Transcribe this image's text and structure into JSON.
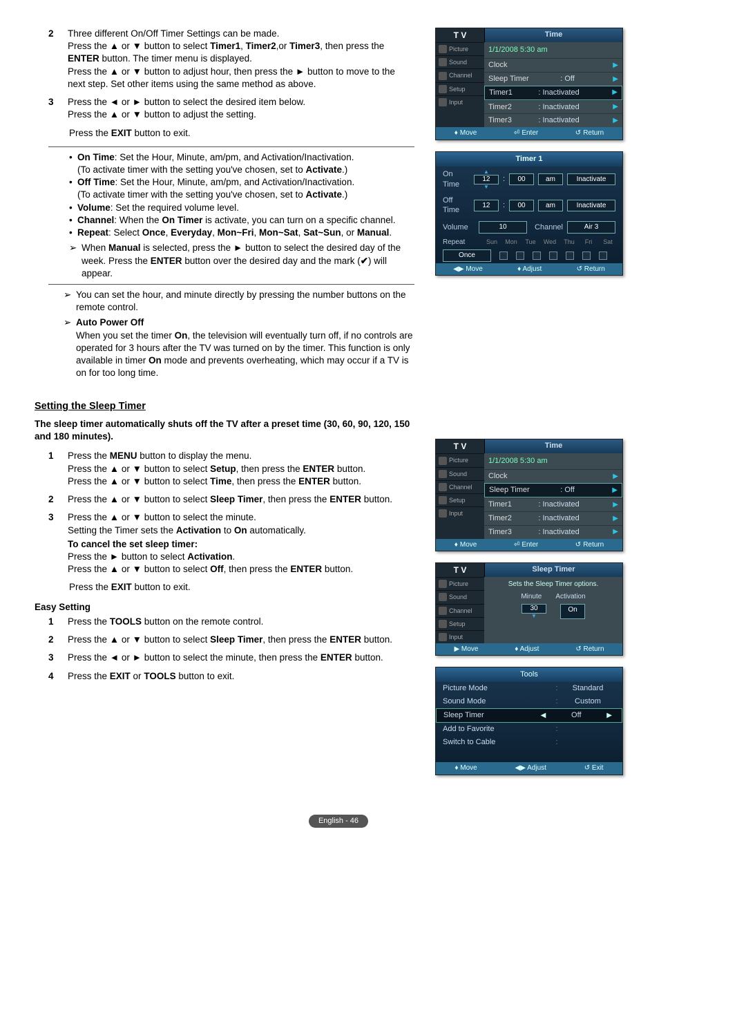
{
  "steps_top": {
    "s2": {
      "num": "2",
      "l1": "Three different On/Off Timer Settings can be made.",
      "l2a": "Press the ▲ or ▼ button to select ",
      "l2b1": "Timer1",
      "l2c": ", ",
      "l2b2": "Timer2",
      "l2d": ",or ",
      "l2b3": "Timer3",
      "l2e": ", then press the ",
      "l3a": "ENTER",
      "l3b": " button. The timer menu is displayed.",
      "l4": "Press the ▲ or ▼ button to adjust hour, then press the ► button to move to the next step. Set other items using the same method as above."
    },
    "s3": {
      "num": "3",
      "l1": "Press the ◄ or ► button to select the desired item below.",
      "l2": "Press the ▲ or ▼ button to adjust the setting.",
      "exit_a": "Press the ",
      "exit_b": "EXIT",
      "exit_c": " button to exit."
    }
  },
  "bullets": {
    "b1a": "On Time",
    "b1b": ": Set the Hour, Minute, am/pm, and Activation/Inactivation.",
    "b1c": "(To activate timer with the setting you've chosen, set to ",
    "b1d": "Activate",
    "b1e": ".)",
    "b2a": "Off Time",
    "b2b": ": Set the Hour, Minute, am/pm, and Activation/Inactivation.",
    "b2c": "(To activate timer with the setting you've chosen, set to ",
    "b2d": "Activate",
    "b2e": ".)",
    "b3a": "Volume",
    "b3b": ": Set the required volume level.",
    "b4a": "Channel",
    "b4b": ": When the ",
    "b4c": "On Timer",
    "b4d": " is activate, you can turn on a specific channel.",
    "b5a": "Repeat",
    "b5b": ": Select ",
    "opts": [
      "Once",
      "Everyday",
      "Mon~Fri",
      "Mon~Sat",
      "Sat~Sun",
      "Manual"
    ],
    "or": ", or ",
    "sep": ", ",
    "b5end": ".",
    "b5sub": "When ",
    "b5sub_b": "Manual",
    "b5sub_c": " is selected, press the ► button to select the desired day of the week. Press the ",
    "b5sub_d": "ENTER",
    "b5sub_e": " button over the desired day and the mark (",
    "b5sub_f": "✔",
    "b5sub_g": ") will appear."
  },
  "notes": {
    "n1": "You can set the hour, and minute directly by pressing the number buttons on the remote control.",
    "n2_title": "Auto Power Off",
    "n2_body_a": "When you set the timer ",
    "n2_body_b": "On",
    "n2_body_c": ", the television will eventually turn off, if no controls are operated for 3 hours after the TV was turned on by the timer. This function is only available in timer ",
    "n2_body_d": "On",
    "n2_body_e": " mode and prevents overheating, which may occur if a TV is on for too long time."
  },
  "sleep": {
    "title": "Setting the Sleep Timer",
    "lead": "The sleep timer automatically shuts off the TV after a preset time (30, 60, 90, 120, 150 and 180 minutes).",
    "s1": {
      "num": "1",
      "a": "Press the ",
      "b": "MENU",
      "c": " button to display the menu.",
      "d": "Press the ▲ or ▼ button to select ",
      "e": "Setup",
      "f": ", then press the ",
      "g": "ENTER",
      "h": " button.",
      "i": "Press the ▲ or ▼ button to select ",
      "j": "Time",
      "k": ", then press the ",
      "l": "ENTER",
      "m": " button."
    },
    "s2": {
      "num": "2",
      "a": "Press the ▲ or ▼ button to select ",
      "b": "Sleep Timer",
      "c": ", then press the ",
      "d": "ENTER",
      "e": " button."
    },
    "s3": {
      "num": "3",
      "a": "Press the ▲ or ▼ button to select the minute.",
      "b": "Setting the Timer sets the ",
      "c": "Activation",
      "d": " to ",
      "e": "On",
      "f": " automatically.",
      "cancel_t": "To cancel the set sleep timer:",
      "g": "Press the ► button to select ",
      "h": "Activation",
      "i": ".",
      "j": "Press the ▲ or ▼ button to select ",
      "k": "Off",
      "l": ", then press the ",
      "m": "ENTER",
      "n": " button.",
      "exit_a": "Press the ",
      "exit_b": "EXIT",
      "exit_c": " button to exit."
    }
  },
  "easy": {
    "title": "Easy Setting",
    "s1": {
      "num": "1",
      "a": "Press the ",
      "b": "TOOLS",
      "c": " button on the remote control."
    },
    "s2": {
      "num": "2",
      "a": "Press the ▲ or ▼ button to select ",
      "b": "Sleep Timer",
      "c": ", then press the ",
      "d": "ENTER",
      "e": " button."
    },
    "s3": {
      "num": "3",
      "a": "Press the ◄ or ► button to select the minute, then press the ",
      "b": "ENTER",
      "c": " button."
    },
    "s4": {
      "num": "4",
      "a": "Press the ",
      "b": "EXIT",
      "c": " or ",
      "d": "TOOLS",
      "e": " button to exit."
    }
  },
  "osd": {
    "tv": "T V",
    "title": "Time",
    "date": "1/1/2008 5:30 am",
    "side": [
      "Picture",
      "Sound",
      "Channel",
      "Setup",
      "Input"
    ],
    "rows1": [
      {
        "label": "Clock",
        "value": "",
        "arrow": true,
        "hl": false
      },
      {
        "label": "Sleep Timer",
        "value": ": Off",
        "arrow": true,
        "hl": false
      },
      {
        "label": "Timer1",
        "value": ": Inactivated",
        "arrow": true,
        "hl": true
      },
      {
        "label": "Timer2",
        "value": ": Inactivated",
        "arrow": true,
        "hl": false
      },
      {
        "label": "Timer3",
        "value": ": Inactivated",
        "arrow": true,
        "hl": false
      }
    ],
    "rows2": [
      {
        "label": "Clock",
        "value": "",
        "arrow": true,
        "hl": false
      },
      {
        "label": "Sleep Timer",
        "value": ": Off",
        "arrow": true,
        "hl": true
      },
      {
        "label": "Timer1",
        "value": ": Inactivated",
        "arrow": true,
        "hl": false
      },
      {
        "label": "Timer2",
        "value": ": Inactivated",
        "arrow": true,
        "hl": false
      },
      {
        "label": "Timer3",
        "value": ": Inactivated",
        "arrow": true,
        "hl": false
      }
    ],
    "footer": {
      "move": "Move",
      "enter": "Enter",
      "ret": "Return"
    }
  },
  "timer1": {
    "title": "Timer 1",
    "on": {
      "label": "On Time",
      "h": "12",
      "m": "00",
      "ap": "am",
      "act": "Inactivate"
    },
    "off": {
      "label": "Off Time",
      "h": "12",
      "m": "00",
      "ap": "am",
      "act": "Inactivate"
    },
    "vol": {
      "label": "Volume",
      "v": "10",
      "ch_l": "Channel",
      "ch_v": "Air 3"
    },
    "rep": {
      "label": "Repeat",
      "days": [
        "Sun",
        "Mon",
        "Tue",
        "Wed",
        "Thu",
        "Fri",
        "Sat"
      ],
      "once": "Once"
    },
    "footer": {
      "move": "Move",
      "adjust": "Adjust",
      "ret": "Return"
    }
  },
  "sleep_osd": {
    "title": "Sleep Timer",
    "caption": "Sets the Sleep Timer options.",
    "min_l": "Minute",
    "act_l": "Activation",
    "min_v": "30",
    "act_v": "On",
    "footer": {
      "move": "Move",
      "adjust": "Adjust",
      "ret": "Return"
    }
  },
  "tools": {
    "title": "Tools",
    "rows": [
      {
        "label": "Picture Mode",
        "value": "Standard",
        "hl": false
      },
      {
        "label": "Sound Mode",
        "value": "Custom",
        "hl": false
      },
      {
        "label": "Sleep Timer",
        "value": "Off",
        "hl": true
      },
      {
        "label": "Add to Favorite",
        "value": "",
        "hl": false
      },
      {
        "label": "Switch to Cable",
        "value": "",
        "hl": false
      }
    ],
    "footer": {
      "move": "Move",
      "adjust": "Adjust",
      "exit": "Exit"
    }
  },
  "page_footer": "English - 46"
}
